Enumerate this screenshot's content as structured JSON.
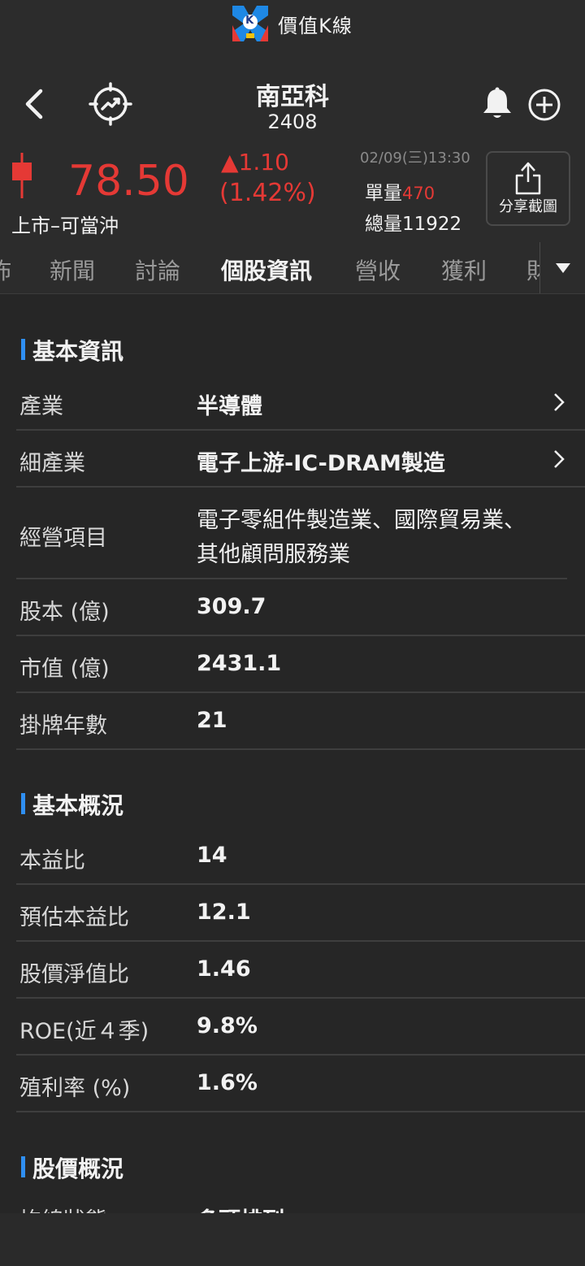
{
  "app": {
    "title": "價值K線",
    "logo_letter": "K"
  },
  "stock": {
    "name": "南亞科",
    "code": "2408",
    "price": "78.50",
    "change": "▲1.10",
    "change_pct": "(1.42%)",
    "market_type": "上市–可當沖",
    "timestamp": "02/09(三)13:30",
    "single_volume_label": "單量",
    "single_volume_value": "470",
    "total_volume": "總量11922",
    "share_label": "分享截圖"
  },
  "tabs": [
    {
      "label": "佈"
    },
    {
      "label": "新聞"
    },
    {
      "label": "討論"
    },
    {
      "label": "個股資訊"
    },
    {
      "label": "營收"
    },
    {
      "label": "獲利"
    },
    {
      "label": "財"
    }
  ],
  "sections": {
    "basic_info": {
      "title": "基本資訊",
      "rows": [
        {
          "label": "產業",
          "value": "半導體"
        },
        {
          "label": "細產業",
          "value": "電子上游-IC-DRAM製造"
        },
        {
          "label": "經營項目",
          "value_line1": "電子零組件製造業、國際貿易業、",
          "value_line2": "其他顧問服務業"
        },
        {
          "label": "股本 (億)",
          "value": "309.7"
        },
        {
          "label": "市值 (億)",
          "value": "2431.1"
        },
        {
          "label": "掛牌年數",
          "value": "21"
        }
      ]
    },
    "overview": {
      "title": "基本概況",
      "rows": [
        {
          "label": "本益比",
          "value": "14"
        },
        {
          "label": "預估本益比",
          "value": "12.1"
        },
        {
          "label": "股價淨值比",
          "value": "1.46"
        },
        {
          "label": "ROE(近４季)",
          "value": "9.8%"
        },
        {
          "label": "殖利率 (%)",
          "value": "1.6%"
        }
      ]
    },
    "price_overview": {
      "title": "股價概況",
      "rows": [
        {
          "label": "均線狀態",
          "value": "多頭排列"
        }
      ]
    }
  },
  "colors": {
    "up_red": "#e53935",
    "accent_blue": "#2f8ff2",
    "background": "#262626"
  }
}
